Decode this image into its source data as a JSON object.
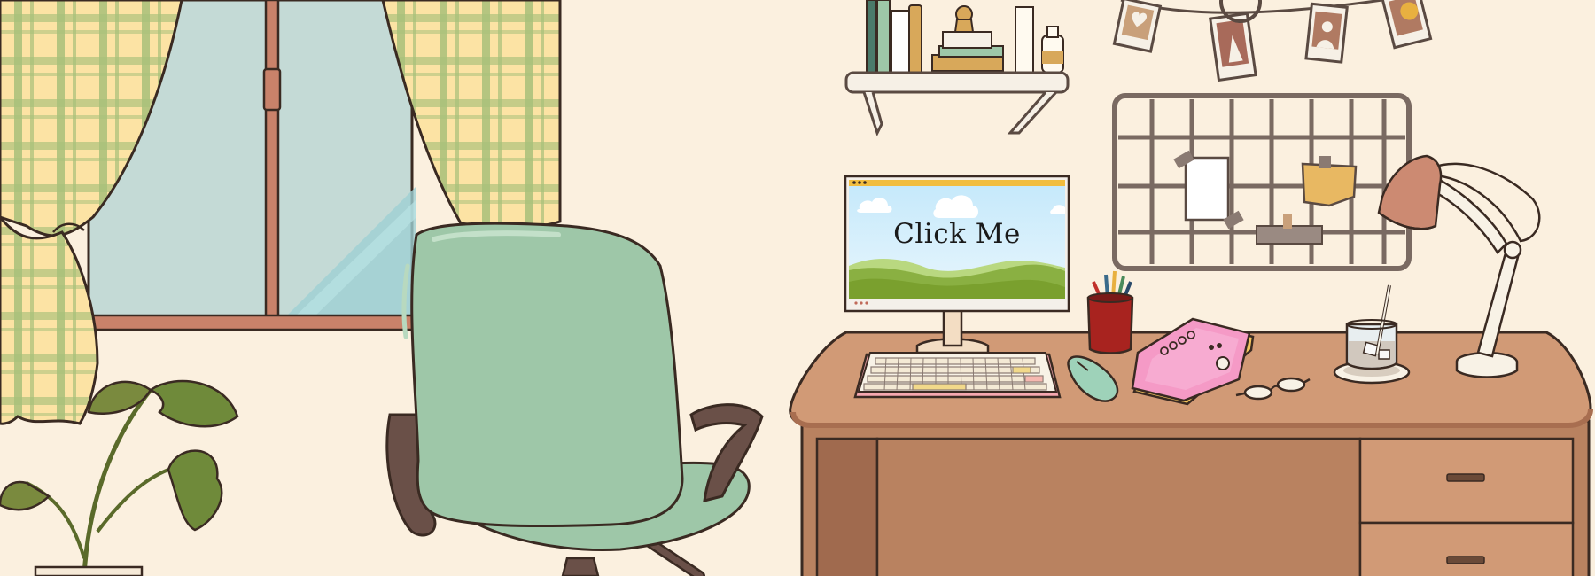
{
  "monitor": {
    "label": "Click Me"
  },
  "colors": {
    "wall": "#fbf0df",
    "desk_top": "#d19a76",
    "desk_body": "#b98260",
    "chair": "#9ec7a8",
    "curtain": "#fce3a4",
    "window_glass": "#c4dad6",
    "binder": "#f59ac6",
    "mouse": "#9ed2b9",
    "pen_cup": "#a8231f",
    "lamp_shade": "#cc8a72"
  }
}
